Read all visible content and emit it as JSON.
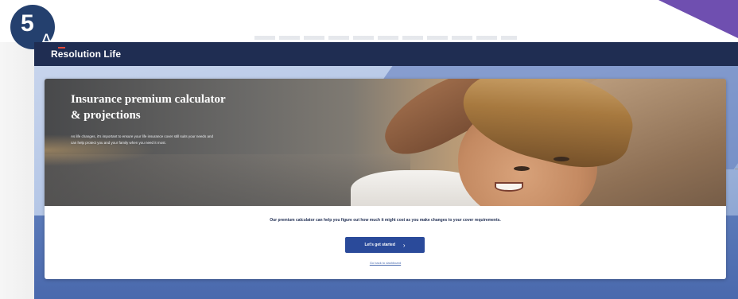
{
  "step": {
    "number": "5",
    "letter": "A"
  },
  "header": {
    "logo_text": "Resolution Life"
  },
  "hero": {
    "title": "Insurance premium calculator & projections",
    "body": "As life changes, it's important to ensure your life insurance cover still suits your needs and can help protect you and your family when you need it most."
  },
  "main": {
    "promo_text": "Our premium calculator can help you figure out how much it might cost as you make changes to your cover requirements.",
    "start_button_label": "Let's get started",
    "back_link": "Go back to dashboard"
  },
  "colors": {
    "brand_navy": "#1f2d52",
    "button_blue": "#2a4a9a",
    "badge": "#24406e",
    "corner_purple": "#6f4fb0"
  }
}
